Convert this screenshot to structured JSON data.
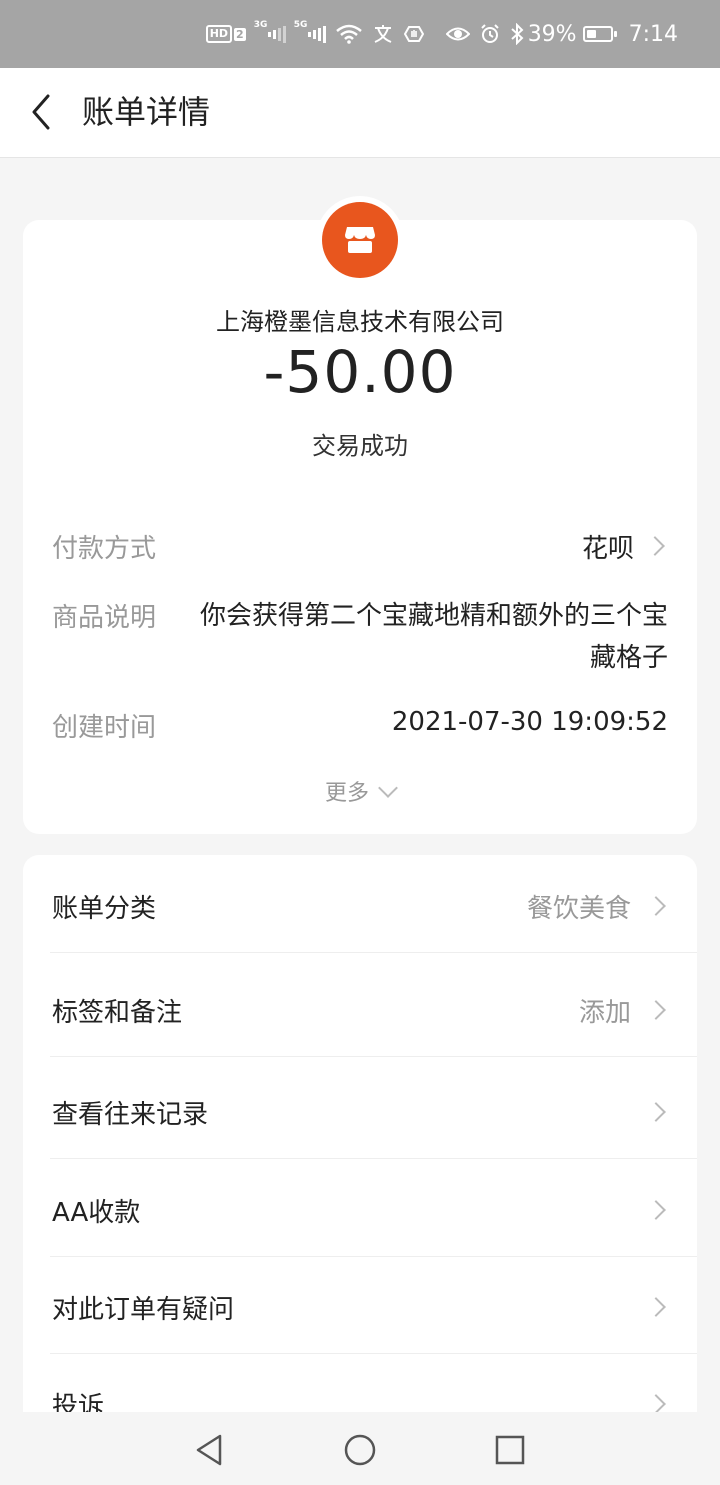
{
  "status_bar": {
    "hd_label": "HD",
    "sim_number": "2",
    "signal1_tag": "3G",
    "signal2_tag": "5G",
    "battery_percent": "39%",
    "battery_level": 0.39,
    "time": "7:14"
  },
  "header": {
    "title": "账单详情"
  },
  "transaction": {
    "merchant": "上海橙墨信息技术有限公司",
    "amount": "-50.00",
    "status": "交易成功",
    "logo_color": "#e8561e"
  },
  "details": {
    "payment_method_label": "付款方式",
    "payment_method_value": "花呗",
    "description_label": "商品说明",
    "description_value": "你会获得第二个宝藏地精和额外的三个宝藏格子",
    "created_time_label": "创建时间",
    "created_time_value": "2021-07-30 19:09:52",
    "more_label": "更多"
  },
  "menu": {
    "items": [
      {
        "label": "账单分类",
        "value": "餐饮美食"
      },
      {
        "label": "标签和备注",
        "value": "添加"
      },
      {
        "label": "查看往来记录",
        "value": ""
      },
      {
        "label": "AA收款",
        "value": ""
      },
      {
        "label": "对此订单有疑问",
        "value": ""
      },
      {
        "label": "投诉",
        "value": ""
      }
    ]
  },
  "icons": {
    "back": "chevron-left-icon",
    "merchant": "shop-icon",
    "sys_back": "triangle-back-icon",
    "sys_home": "circle-home-icon",
    "sys_recent": "square-recent-icon"
  }
}
